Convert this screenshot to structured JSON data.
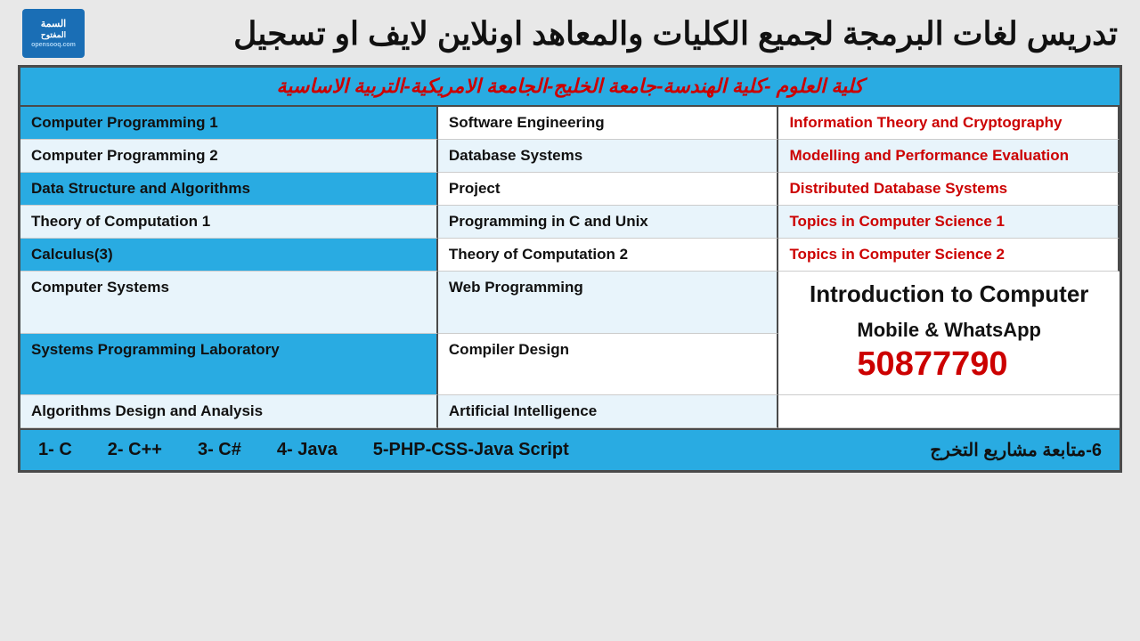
{
  "title": "تدريس لغات البرمجة لجميع الكليات والمعاهد اونلاين لايف او تسجيل",
  "header": "كلية العلوم -كلية الهندسة-جامعة الخليج-الجامعة الامريكية-التربية الاساسية",
  "logo_line1": "السمة",
  "logo_line2": "المفتوح",
  "logo_sub": "opensooq.com",
  "col1": [
    "Computer Programming 1",
    "Computer Programming 2",
    "Data Structure and Algorithms",
    "Theory of Computation 1",
    "Calculus(3)",
    "Computer Systems",
    "Systems Programming Laboratory",
    "Algorithms Design and Analysis"
  ],
  "col2": [
    "Software Engineering",
    "Database Systems",
    "Project",
    "Programming in C and Unix",
    "Theory of Computation 2",
    "Web Programming",
    "Compiler Design",
    "Artificial Intelligence"
  ],
  "col3_items": [
    "Information Theory and Cryptography",
    "Modelling and Performance Evaluation",
    "Distributed Database Systems",
    "Topics in Computer Science 1",
    "Topics in Computer Science 2"
  ],
  "intro_label": "Introduction to Computer",
  "contact_label": "Mobile & WhatsApp",
  "phone": "50877790",
  "footer": {
    "items": [
      "1- C",
      "2- C++",
      "3- C#",
      "4- Java",
      "5-PHP-CSS-Java Script"
    ],
    "arabic": "6-متابعة مشاريع التخرج"
  }
}
